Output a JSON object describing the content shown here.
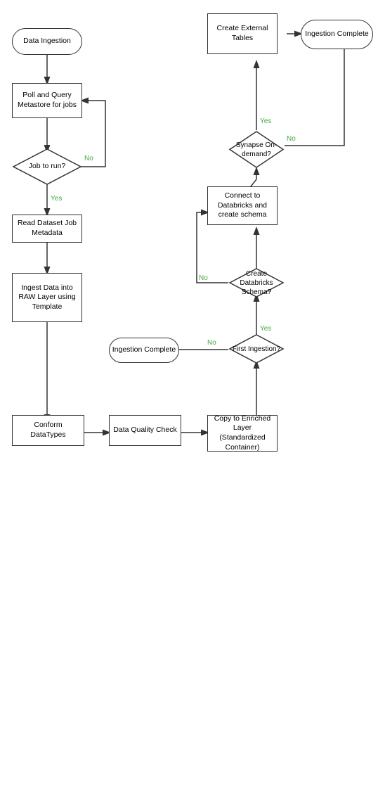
{
  "nodes": {
    "data_ingestion": "Data Ingestion",
    "poll_query": "Poll and Query Metastore for jobs",
    "job_to_run": "Job to run?",
    "read_dataset": "Read Dataset Job Metadata",
    "ingest_data": "Ingest Data into RAW Layer using Template",
    "conform_datatypes": "Conform DataTypes",
    "data_quality": "Data Quality Check",
    "copy_enriched": "Copy to Enriched Layer (Standardized Container)",
    "first_ingestion": "First Ingestion?",
    "ingestion_complete_left": "Ingestion Complete",
    "create_databricks": "Create Databricks Schema?",
    "connect_databricks": "Connect to Databricks and create schema",
    "synapse_ondemand": "Synapse On-demand?",
    "create_external": "Create External Tables",
    "ingestion_complete_right": "Ingestion Complete"
  },
  "labels": {
    "yes": "Yes",
    "no": "No"
  }
}
